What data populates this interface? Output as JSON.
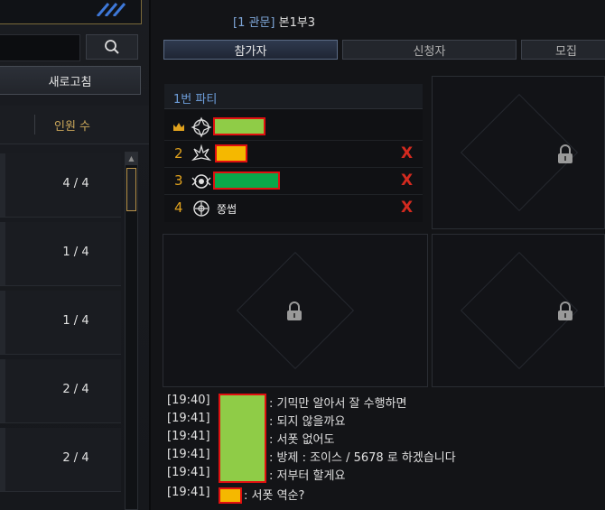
{
  "left_panel": {
    "refresh_label": "새로고침",
    "column_header": "인원 수",
    "rows": [
      {
        "count": "4 / 4"
      },
      {
        "count": "1 / 4"
      },
      {
        "count": "1 / 4"
      },
      {
        "count": "2 / 4"
      },
      {
        "count": "2 / 4"
      }
    ]
  },
  "header": {
    "tag": "[1 관문]",
    "title": "본1부3"
  },
  "tabs": [
    {
      "label": "참가자",
      "active": true
    },
    {
      "label": "신청자",
      "active": false
    },
    {
      "label": "모집",
      "active": false
    }
  ],
  "party": {
    "title": "1번 파티",
    "members": [
      {
        "slot": "",
        "leader": true,
        "name": "",
        "redact_color": "#8fcc47",
        "kick": ""
      },
      {
        "slot": "2",
        "leader": false,
        "name": "",
        "redact_color": "#f5b800",
        "kick": "X"
      },
      {
        "slot": "3",
        "leader": false,
        "name": "",
        "redact_color": "#0aa84a",
        "kick": "X"
      },
      {
        "slot": "4",
        "leader": false,
        "name": "쫑썹",
        "redact_color": "",
        "kick": "X"
      }
    ]
  },
  "chat": [
    {
      "time": "[19:40]",
      "text": ": 기믹만 알아서 잘 수행하면"
    },
    {
      "time": "[19:41]",
      "text": ": 되지 않을까요"
    },
    {
      "time": "[19:41]",
      "text": ": 서폿 없어도"
    },
    {
      "time": "[19:41]",
      "text": ": 방제 : 조이스 / 5678 로 하겠습니다"
    },
    {
      "time": "[19:41]",
      "text": ": 저부터 할게요"
    },
    {
      "time": "[19:41]",
      "text": ": 서폿 역순?"
    }
  ],
  "colors": {
    "accent_gold": "#c9a65a",
    "party_blue": "#6e9fdc",
    "kick_red": "#d32a1f",
    "slot_orange": "#e0a21e"
  }
}
